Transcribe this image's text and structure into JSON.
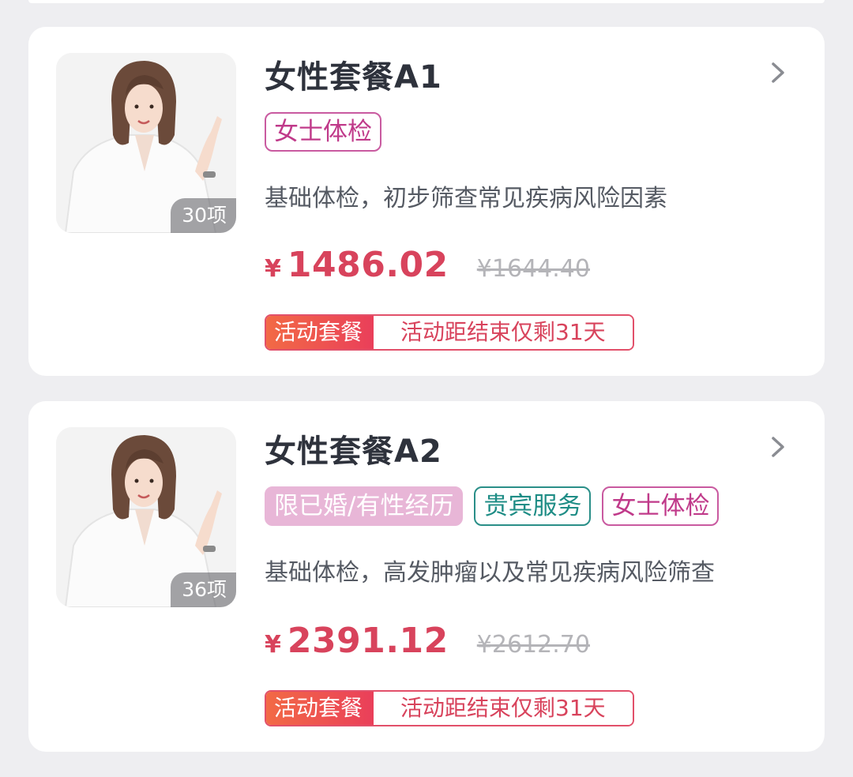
{
  "packages": [
    {
      "title": "女性套餐A1",
      "item_count": "30项",
      "tags": {
        "women": "女士体检"
      },
      "description": "基础体检，初步筛查常见疾病风险因素",
      "currency": "¥",
      "price": "1486.02",
      "original_price": "¥1644.40",
      "promo_label": "活动套餐",
      "promo_text": "活动距结束仅剩31天"
    },
    {
      "title": "女性套餐A2",
      "item_count": "36项",
      "tags": {
        "married": "限已婚/有性经历",
        "vip": "贵宾服务",
        "women": "女士体检"
      },
      "description": "基础体检，高发肿瘤以及常见疾病风险筛查",
      "currency": "¥",
      "price": "2391.12",
      "original_price": "¥2612.70",
      "promo_label": "活动套餐",
      "promo_text": "活动距结束仅剩31天"
    }
  ],
  "colors": {
    "price": "#d8435c",
    "tag_women": "#c03a8a",
    "tag_married_bg": "#e8b6d7",
    "tag_vip": "#1f8d86",
    "promo_gradient_start": "#f26a45",
    "promo_gradient_end": "#ea3f5a"
  },
  "icons": {
    "chevron": "chevron-right-icon",
    "thumbnail": "woman-pointing-photo"
  }
}
